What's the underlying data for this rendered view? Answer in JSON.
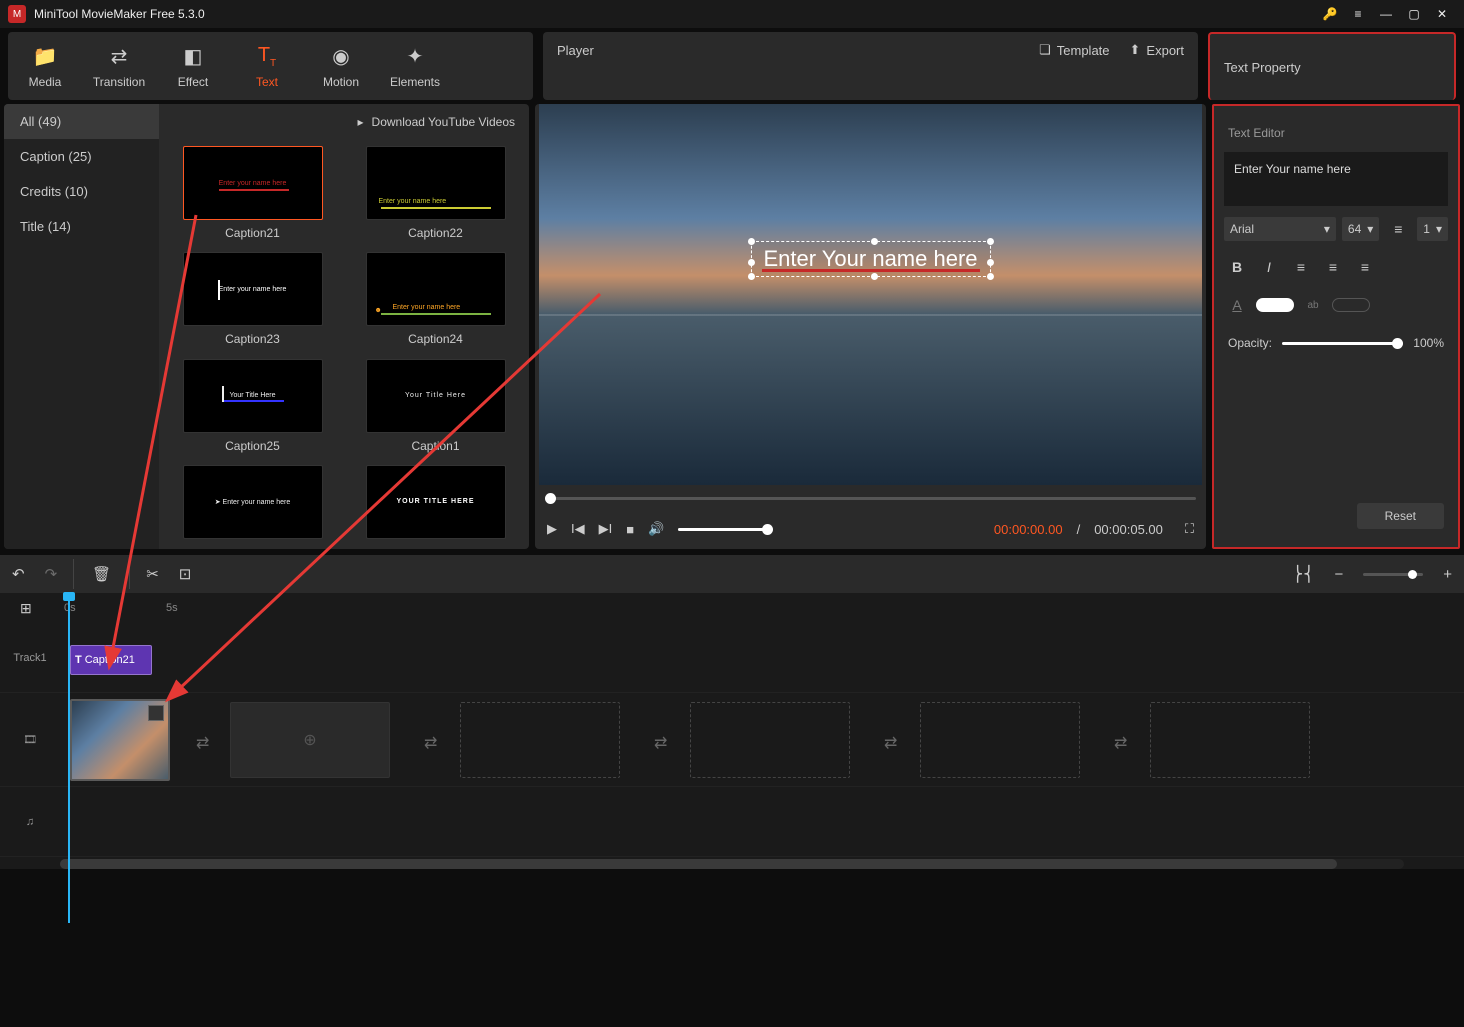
{
  "titlebar": {
    "title": "MiniTool MovieMaker Free 5.3.0"
  },
  "toolbar": {
    "items": [
      {
        "label": "Media"
      },
      {
        "label": "Transition"
      },
      {
        "label": "Effect"
      },
      {
        "label": "Text"
      },
      {
        "label": "Motion"
      },
      {
        "label": "Elements"
      }
    ]
  },
  "categories": {
    "items": [
      {
        "label": "All (49)"
      },
      {
        "label": "Caption (25)"
      },
      {
        "label": "Credits (10)"
      },
      {
        "label": "Title (14)"
      }
    ]
  },
  "gallery": {
    "download_label": "Download YouTube Videos",
    "items": [
      {
        "label": "Caption21",
        "preview": "Enter your name here"
      },
      {
        "label": "Caption22",
        "preview": "Enter your name here"
      },
      {
        "label": "Caption23",
        "preview": "Enter your name here"
      },
      {
        "label": "Caption24",
        "preview": "Enter your name here"
      },
      {
        "label": "Caption25",
        "preview": "Your Title Here"
      },
      {
        "label": "Caption1",
        "preview": "Your  Title Here"
      },
      {
        "label": "",
        "preview": "Enter your name here"
      },
      {
        "label": "",
        "preview": "YOUR TITLE HERE"
      }
    ]
  },
  "player": {
    "title": "Player",
    "template_label": "Template",
    "export_label": "Export",
    "overlay_text": "Enter Your name here",
    "time_current": "00:00:00.00",
    "time_sep": "/",
    "time_total": "00:00:05.00"
  },
  "text_property": {
    "title": "Text Property",
    "editor_label": "Text Editor",
    "editor_value": "Enter Your name here",
    "font": "Arial",
    "size": "64",
    "line": "1",
    "opacity_label": "Opacity:",
    "opacity_value": "100%",
    "reset_label": "Reset"
  },
  "timeline": {
    "ticks": {
      "t0": "0s",
      "t5": "5s"
    },
    "track1_label": "Track1",
    "caption_clip": "Caption21"
  }
}
